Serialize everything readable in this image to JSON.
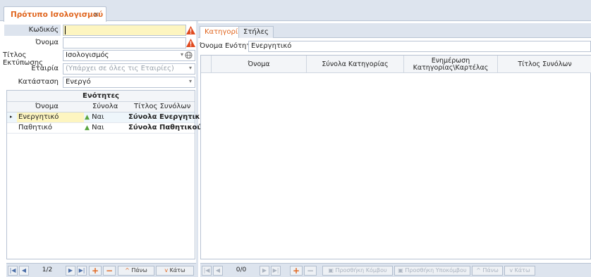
{
  "tab": {
    "title": "Πρότυπο Ισολογισμού",
    "close": "×"
  },
  "form": {
    "code_label": "Κωδικός",
    "code_value": "",
    "name_label": "Όνομα",
    "name_value": "",
    "print_title_label": "Τίτλος Εκτύπωσης",
    "print_title_value": "Ισολογισμός",
    "company_label": "Εταιρία",
    "company_placeholder": "(Υπάρχει σε όλες τις Εταιρίες)",
    "status_label": "Κατάσταση",
    "status_value": "Ενεργό"
  },
  "sections": {
    "title": "Ενότητες",
    "columns": [
      "Όνομα",
      "Σύνολα",
      "Τίτλος Συνόλων"
    ],
    "rows": [
      {
        "name": "Ενεργητικό",
        "totals": "Ναι",
        "totals_title": "Σύνολα Ενεργητικού"
      },
      {
        "name": "Παθητικό",
        "totals": "Ναι",
        "totals_title": "Σύνολα Παθητικού"
      }
    ],
    "nav": {
      "position": "1/2",
      "up": "Πάνω",
      "down": "Κάτω"
    }
  },
  "right": {
    "tabs": [
      "Κατηγορίες",
      "Στήλες"
    ],
    "section_name_label": "Όνομα Ενότητας",
    "section_name_value": "Ενεργητικό",
    "columns": [
      "Όνομα",
      "Σύνολα Κατηγορίας",
      "Ενημέρωση Κατηγορίας\\Καρτέλας",
      "Τίτλος Συνόλων"
    ],
    "nav": {
      "position": "0/0",
      "add_node": "Προσθήκη Κόμβου",
      "add_subnode": "Προσθήκη Υποκόμβου",
      "up": "Πάνω",
      "down": "Κάτω"
    }
  },
  "colors": {
    "accent": "#e0661f",
    "panel": "#dde4ee",
    "highlight": "#fdf5c0"
  }
}
